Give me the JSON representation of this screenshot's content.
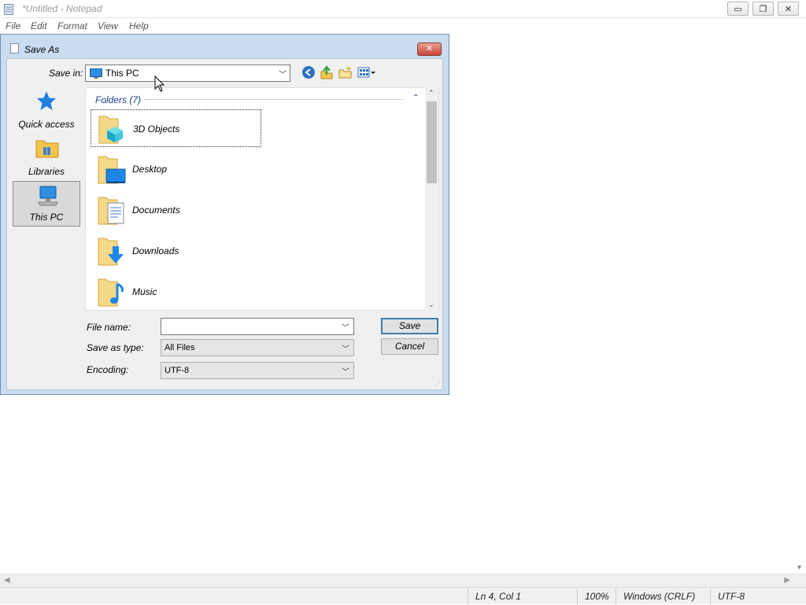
{
  "notepad": {
    "title": "*Untitled - Notepad",
    "menu": [
      "File",
      "Edit",
      "Format",
      "View",
      "Help"
    ],
    "caption_buttons": {
      "minimize": "▭",
      "restore": "❐",
      "close": "✕"
    },
    "statusbar": {
      "position": "Ln 4, Col 1",
      "zoom": "100%",
      "line_ending": "Windows (CRLF)",
      "encoding": "UTF-8"
    }
  },
  "dialog": {
    "title": "Save As",
    "save_in_label": "Save in:",
    "save_in_value": "This PC",
    "places": [
      {
        "label": "Quick access",
        "icon": "star-icon"
      },
      {
        "label": "Libraries",
        "icon": "libraries-icon"
      },
      {
        "label": "This PC",
        "icon": "this-pc-icon",
        "selected": true
      }
    ],
    "group_header": "Folders (7)",
    "folders": [
      {
        "name": "3D Objects",
        "icon": "3d-objects-folder-icon"
      },
      {
        "name": "Desktop",
        "icon": "desktop-folder-icon"
      },
      {
        "name": "Documents",
        "icon": "documents-folder-icon"
      },
      {
        "name": "Downloads",
        "icon": "downloads-folder-icon"
      },
      {
        "name": "Music",
        "icon": "music-folder-icon"
      }
    ],
    "file_name_label": "File name:",
    "file_name_value": "",
    "save_as_type_label": "Save as type:",
    "save_as_type_value": "All Files",
    "encoding_label": "Encoding:",
    "encoding_value": "UTF-8",
    "save_button": "Save",
    "cancel_button": "Cancel"
  },
  "colors": {
    "dialog_frame": "#c9dcf0",
    "close_button": "#c9453a",
    "group_header_text": "#1e3f8a",
    "default_button_border": "#3c7fb1"
  }
}
